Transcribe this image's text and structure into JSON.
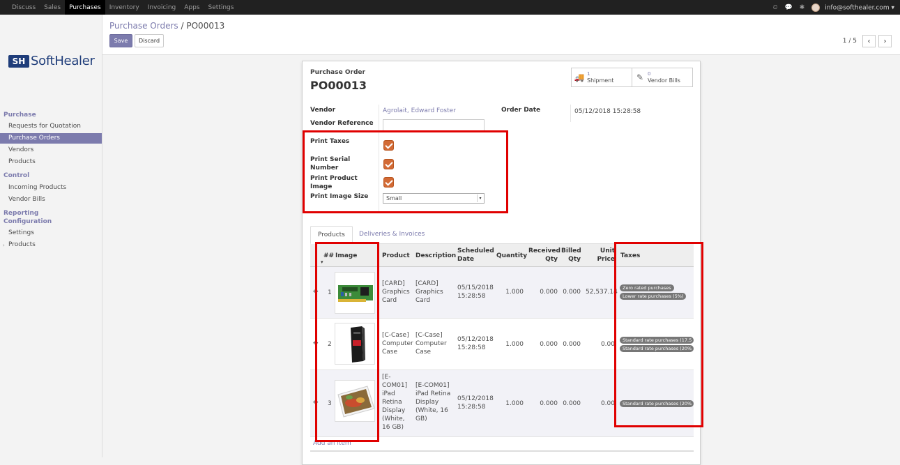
{
  "topbar": {
    "menu": [
      "Discuss",
      "Sales",
      "Purchases",
      "Inventory",
      "Invoicing",
      "Apps",
      "Settings"
    ],
    "active": "Purchases",
    "user": "info@softhealer.com"
  },
  "sidebar": {
    "logo": {
      "mark": "SH",
      "text": "SoftHealer"
    },
    "sections": [
      {
        "title": "Purchase",
        "items": [
          "Requests for Quotation",
          "Purchase Orders",
          "Vendors",
          "Products"
        ]
      },
      {
        "title": "Control",
        "items": [
          "Incoming Products",
          "Vendor Bills"
        ]
      },
      {
        "title": "Reporting",
        "items": []
      },
      {
        "title": "Configuration",
        "items": [
          "Settings",
          "Products"
        ]
      }
    ],
    "active_item": "Purchase Orders"
  },
  "breadcrumb": {
    "parent": "Purchase Orders",
    "separator": "/",
    "current": "PO00013"
  },
  "buttons": {
    "save": "Save",
    "discard": "Discard"
  },
  "pager": {
    "value": "1 / 5",
    "prev": "‹",
    "next": "›"
  },
  "form": {
    "record_label": "Purchase Order",
    "record_name": "PO00013",
    "smart_buttons": [
      {
        "count": "1",
        "label": "Shipment",
        "icon": "truck-icon"
      },
      {
        "count": "0",
        "label": "Vendor Bills",
        "icon": "edit-icon"
      }
    ],
    "vendor_label": "Vendor",
    "vendor_value": "Agrolait, Edward Foster",
    "vendor_ref_label": "Vendor Reference",
    "order_date_label": "Order Date",
    "order_date_value": "05/12/2018 15:28:58",
    "print_taxes_label": "Print Taxes",
    "print_serial_label_1": "Print Serial",
    "print_serial_label_2": "Number",
    "print_image_label_1": "Print Product",
    "print_image_label_2": "Image",
    "print_image_size_label": "Print Image Size",
    "print_image_size_value": "Small",
    "print_taxes": true,
    "print_serial": true,
    "print_image": true
  },
  "tabs": [
    "Products",
    "Deliveries & Invoices"
  ],
  "table": {
    "headers": {
      "num": "##",
      "image": "Image",
      "product": "Product",
      "description": "Description",
      "scheduled_1": "Scheduled",
      "scheduled_2": "Date",
      "quantity": "Quantity",
      "received_1": "Received",
      "received_2": "Qty",
      "billed_1": "Billed",
      "billed_2": "Qty",
      "unit_1": "Unit",
      "unit_2": "Price",
      "taxes": "Taxes"
    },
    "rows": [
      {
        "num": "1",
        "product": [
          "[CARD]",
          "Graphics",
          "Card"
        ],
        "description": [
          "[CARD]",
          "Graphics",
          "Card"
        ],
        "date": [
          "05/15/2018",
          "15:28:58"
        ],
        "quantity": "1.000",
        "received": "0.000",
        "billed": "0.000",
        "price": "52,537.14",
        "taxes": [
          "Zero rated purchases",
          "Lower rate purchases (5%)"
        ]
      },
      {
        "num": "2",
        "product": [
          "[C-Case]",
          "Computer",
          "Case"
        ],
        "description": [
          "[C-Case]",
          "Computer",
          "Case"
        ],
        "date": [
          "05/12/2018",
          "15:28:58"
        ],
        "quantity": "1.000",
        "received": "0.000",
        "billed": "0.000",
        "price": "0.00",
        "taxes": [
          "Standard rate purchases (17.5",
          "Standard rate purchases (20%"
        ]
      },
      {
        "num": "3",
        "product": [
          "[E-",
          "COM01]",
          "iPad",
          "Retina",
          "Display",
          "(White,",
          "16 GB)"
        ],
        "description": [
          "[E-COM01]",
          "iPad Retina",
          "Display",
          "(White, 16",
          "GB)"
        ],
        "date": [
          "05/12/2018",
          "15:28:58"
        ],
        "quantity": "1.000",
        "received": "0.000",
        "billed": "0.000",
        "price": "0.00",
        "taxes": [
          "Standard rate purchases (20%"
        ]
      }
    ],
    "add_line": "Add an item"
  },
  "colors": {
    "accent": "#7c7bad",
    "highlight": "#e00000",
    "checkbox": "#d26a35",
    "topbar": "#212121"
  }
}
